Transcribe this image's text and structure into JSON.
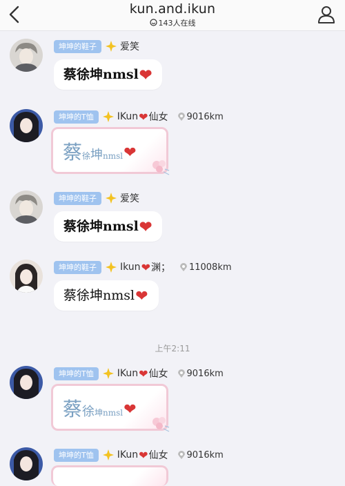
{
  "header": {
    "title": "kun.and.ikun",
    "online_count": "143人在线"
  },
  "time_divider": "上午2:11",
  "messages": [
    {
      "tag": "坤坤的鞋子",
      "name": "爱笑",
      "text": "蔡徐坤nmsl",
      "type": "text"
    },
    {
      "tag": "坤坤的T恤",
      "name_a": "IKun",
      "name_b": "仙女",
      "distance": "9016km",
      "card": {
        "c1": "蔡",
        "c2": "徐",
        "c3": "坤",
        "c4": "nmsl"
      }
    },
    {
      "tag": "坤坤的鞋子",
      "name": "爱笑",
      "text": "蔡徐坤nmsl",
      "type": "text"
    },
    {
      "tag": "坤坤的鞋子",
      "name_a": "Ikun",
      "name_b": "渊；",
      "distance": "11008km",
      "text": "蔡徐坤nmsl"
    },
    {
      "tag": "坤坤的T恤",
      "name_a": "IKun",
      "name_b": "仙女",
      "distance": "9016km",
      "card": {
        "c1": "蔡",
        "c2": "徐",
        "c3": "坤",
        "c4": "nmsl"
      }
    },
    {
      "tag": "坤坤的T恤",
      "name_a": "IKun",
      "name_b": "仙女",
      "distance": "9016km"
    }
  ],
  "colors": {
    "tag_bg": "#9fc3ef",
    "heart": "#d93636",
    "card_border": "#f1c9d6"
  }
}
